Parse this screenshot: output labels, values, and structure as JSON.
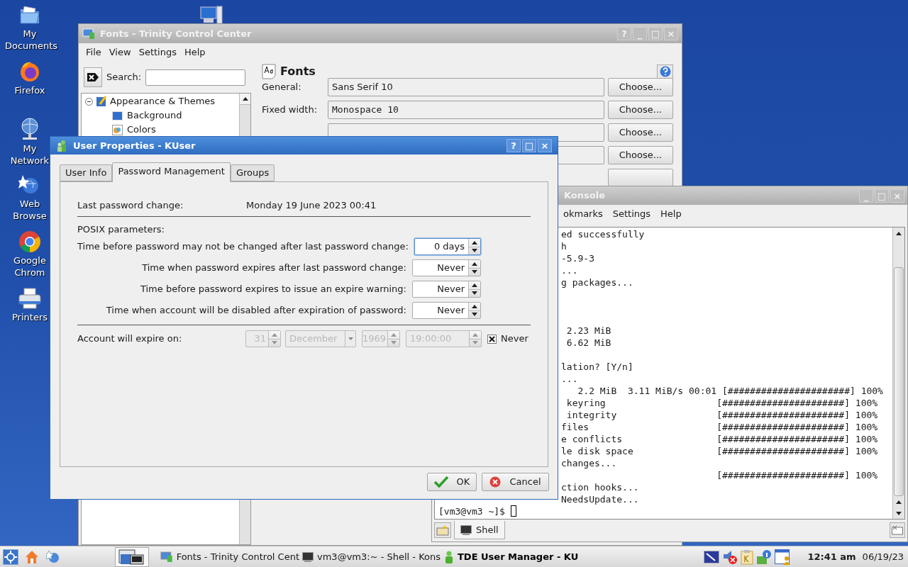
{
  "desktop_icons": [
    {
      "label": "My Documents"
    },
    {
      "label": "Firefox"
    },
    {
      "label": "My Network"
    },
    {
      "label": "Web Browse"
    },
    {
      "label": "Google Chrom"
    },
    {
      "label": "Printers"
    }
  ],
  "control_center": {
    "title": "Fonts - Trinity Control Center",
    "title_buttons": [
      "?",
      "_",
      "□",
      "×"
    ],
    "menu": [
      "File",
      "View",
      "Settings",
      "Help"
    ],
    "search_label": "Search:",
    "tree": [
      {
        "label": "Appearance & Themes",
        "expanded": true,
        "children": [
          {
            "label": "Background"
          },
          {
            "label": "Colors"
          }
        ]
      }
    ],
    "heading": "Fonts",
    "rows": [
      {
        "kind": "sans",
        "label": "General:",
        "value": "Sans Serif 10",
        "button": "Choose..."
      },
      {
        "kind": "mono",
        "label": "Fixed width:",
        "value": "Monospace 10",
        "button": "Choose..."
      },
      {
        "kind": "sans",
        "button": "Choose..."
      },
      {
        "kind": "sans",
        "button": "Choose..."
      },
      {
        "kind": "cut"
      }
    ]
  },
  "konsole": {
    "title": "Konsole",
    "title_buttons": [
      "_",
      "□",
      "×"
    ],
    "menu": [
      "okmarks",
      "Settings",
      "Help"
    ],
    "lines": [
      {
        "kind": "output",
        "text": "ed successfully"
      },
      {
        "kind": "output",
        "text": "h"
      },
      {
        "kind": "output",
        "text": "-5.9-3"
      },
      {
        "kind": "output",
        "text": "..."
      },
      {
        "kind": "output",
        "text": "g packages..."
      },
      {
        "kind": "blank"
      },
      {
        "kind": "blank"
      },
      {
        "kind": "blank"
      },
      {
        "kind": "output",
        "text": " 2.23 MiB"
      },
      {
        "kind": "output",
        "text": " 6.62 MiB"
      },
      {
        "kind": "blank"
      },
      {
        "kind": "output",
        "text": "lation? [Y/n]"
      },
      {
        "kind": "output",
        "text": "..."
      },
      {
        "kind": "output",
        "text": "   2.2 MiB  3.11 MiB/s 00:01 [######################] 100%"
      },
      {
        "kind": "output",
        "text": " keyring                    [######################] 100%"
      },
      {
        "kind": "output",
        "text": " integrity                  [######################] 100%"
      },
      {
        "kind": "output",
        "text": "files                       [######################] 100%"
      },
      {
        "kind": "output",
        "text": "e conflicts                 [######################] 100%"
      },
      {
        "kind": "output",
        "text": "le disk space               [######################] 100%"
      },
      {
        "kind": "output",
        "text": "changes..."
      },
      {
        "kind": "output",
        "text": "                            [######################] 100%"
      },
      {
        "kind": "output",
        "text": "ction hooks..."
      },
      {
        "kind": "output",
        "text": "NeedsUpdate..."
      },
      {
        "kind": "prompt",
        "text": "[vm3@vm3 ~]$ "
      }
    ],
    "tab": "Shell"
  },
  "dialog": {
    "title": "User Properties - KUser",
    "title_buttons": [
      "?",
      "□",
      "×"
    ],
    "tabs": [
      {
        "label": "User Info",
        "selected": false
      },
      {
        "label": "Password Management",
        "selected": true
      },
      {
        "label": "Groups",
        "selected": false
      }
    ],
    "last_change": {
      "label": "Last password change:",
      "value": "Monday 19 June 2023 00:41"
    },
    "section": "POSIX parameters:",
    "params": [
      {
        "label": "Time before password may not be changed after last password change:",
        "value": "0 days",
        "focused": true
      },
      {
        "label": "Time when password expires after last password change:",
        "value": "Never",
        "focused": false
      },
      {
        "label": "Time before password expires to issue an expire warning:",
        "value": "Never",
        "focused": false
      },
      {
        "label": "Time when account will be disabled after expiration of password:",
        "value": "Never",
        "focused": false
      }
    ],
    "expire": {
      "label": "Account will expire on:",
      "day": "31",
      "month": "December",
      "year": "1969",
      "time": "19:00:00",
      "disabled": true,
      "never_label": "Never",
      "never_checked": true
    },
    "buttons": [
      {
        "kind": "ok",
        "label": "OK"
      },
      {
        "kind": "cancel",
        "label": "Cancel"
      }
    ]
  },
  "taskbar": {
    "tasks": [
      {
        "label": "Fonts - Trinity Control Cent",
        "selected": false
      },
      {
        "label": "vm3@vm3:~ - Shell - Kons",
        "selected": false
      },
      {
        "label": "TDE User Manager - KU",
        "selected": true
      }
    ],
    "time": "12:41 am",
    "date": "06/19/23"
  }
}
